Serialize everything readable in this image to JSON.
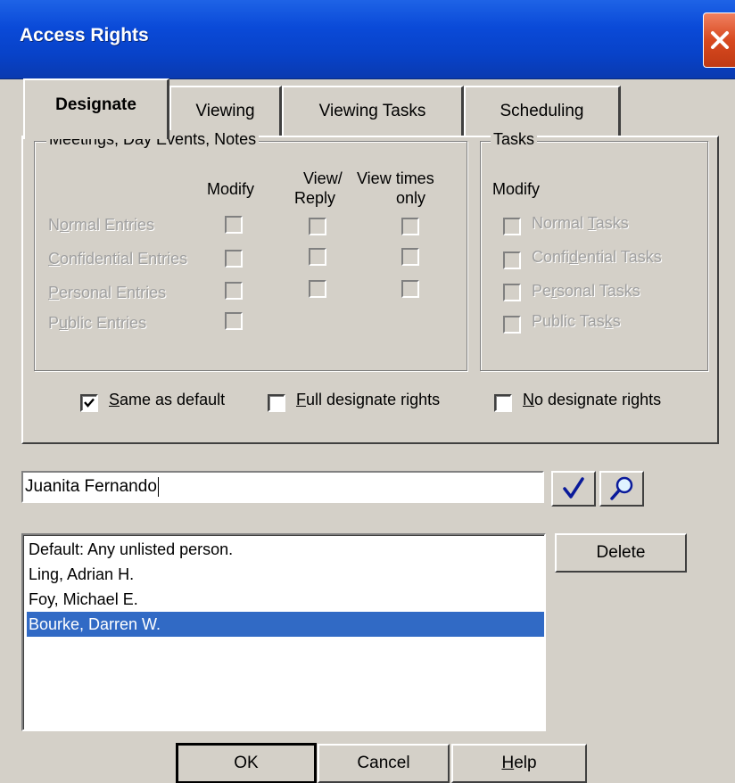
{
  "window": {
    "title": "Access Rights"
  },
  "tabs": [
    {
      "label": "Designate",
      "active": true
    },
    {
      "label": "Viewing"
    },
    {
      "label": "Viewing Tasks"
    },
    {
      "label": "Scheduling"
    }
  ],
  "meetings_group": {
    "title": "Meetings, Day Events, Notes",
    "col_modify": "Modify",
    "col_view_reply_1": "View/",
    "col_view_reply_2": "Reply",
    "col_view_times_1": "View times",
    "col_view_times_2": "only",
    "rows": {
      "normal": {
        "pre": "N",
        "ul": "o",
        "post": "rmal Entries"
      },
      "confidential": {
        "pre": "",
        "ul": "C",
        "post": "onfidential Entries"
      },
      "personal": {
        "pre": "",
        "ul": "P",
        "post": "ersonal Entries"
      },
      "public": {
        "pre": "P",
        "ul": "u",
        "post": "blic Entries"
      }
    }
  },
  "tasks_group": {
    "title": "Tasks",
    "col_modify": "Modify",
    "items": {
      "normal": {
        "pre": "Normal ",
        "ul": "T",
        "post": "asks"
      },
      "confidential": {
        "pre": "Confi",
        "ul": "d",
        "post": "ential Tasks"
      },
      "personal": {
        "pre": "Pe",
        "ul": "r",
        "post": "sonal Tasks"
      },
      "public": {
        "pre": "Public Tas",
        "ul": "k",
        "post": "s"
      }
    }
  },
  "options": {
    "same_default": {
      "pre": "",
      "ul": "S",
      "post": "ame as default",
      "checked": true
    },
    "full_rights": {
      "pre": "",
      "ul": "F",
      "post": "ull designate rights",
      "checked": false
    },
    "no_rights": {
      "pre": "",
      "ul": "N",
      "post": "o designate rights",
      "checked": false
    }
  },
  "name_input": {
    "value": "Juanita Fernando"
  },
  "icons": {
    "accept": "checkmark-icon",
    "search": "magnifier-icon",
    "close": "close-icon"
  },
  "delete_label": "Delete",
  "people": [
    {
      "name": "Default: Any unlisted person."
    },
    {
      "name": "Ling, Adrian H."
    },
    {
      "name": "Foy, Michael E."
    },
    {
      "name": "Bourke, Darren W.",
      "selected": true
    }
  ],
  "buttons": {
    "ok": "OK",
    "cancel": "Cancel",
    "help": {
      "pre": "",
      "ul": "H",
      "post": "elp"
    }
  },
  "colors": {
    "title_bar": "#0a4ad8",
    "selection": "#316ac5",
    "face": "#d4d0c8"
  }
}
